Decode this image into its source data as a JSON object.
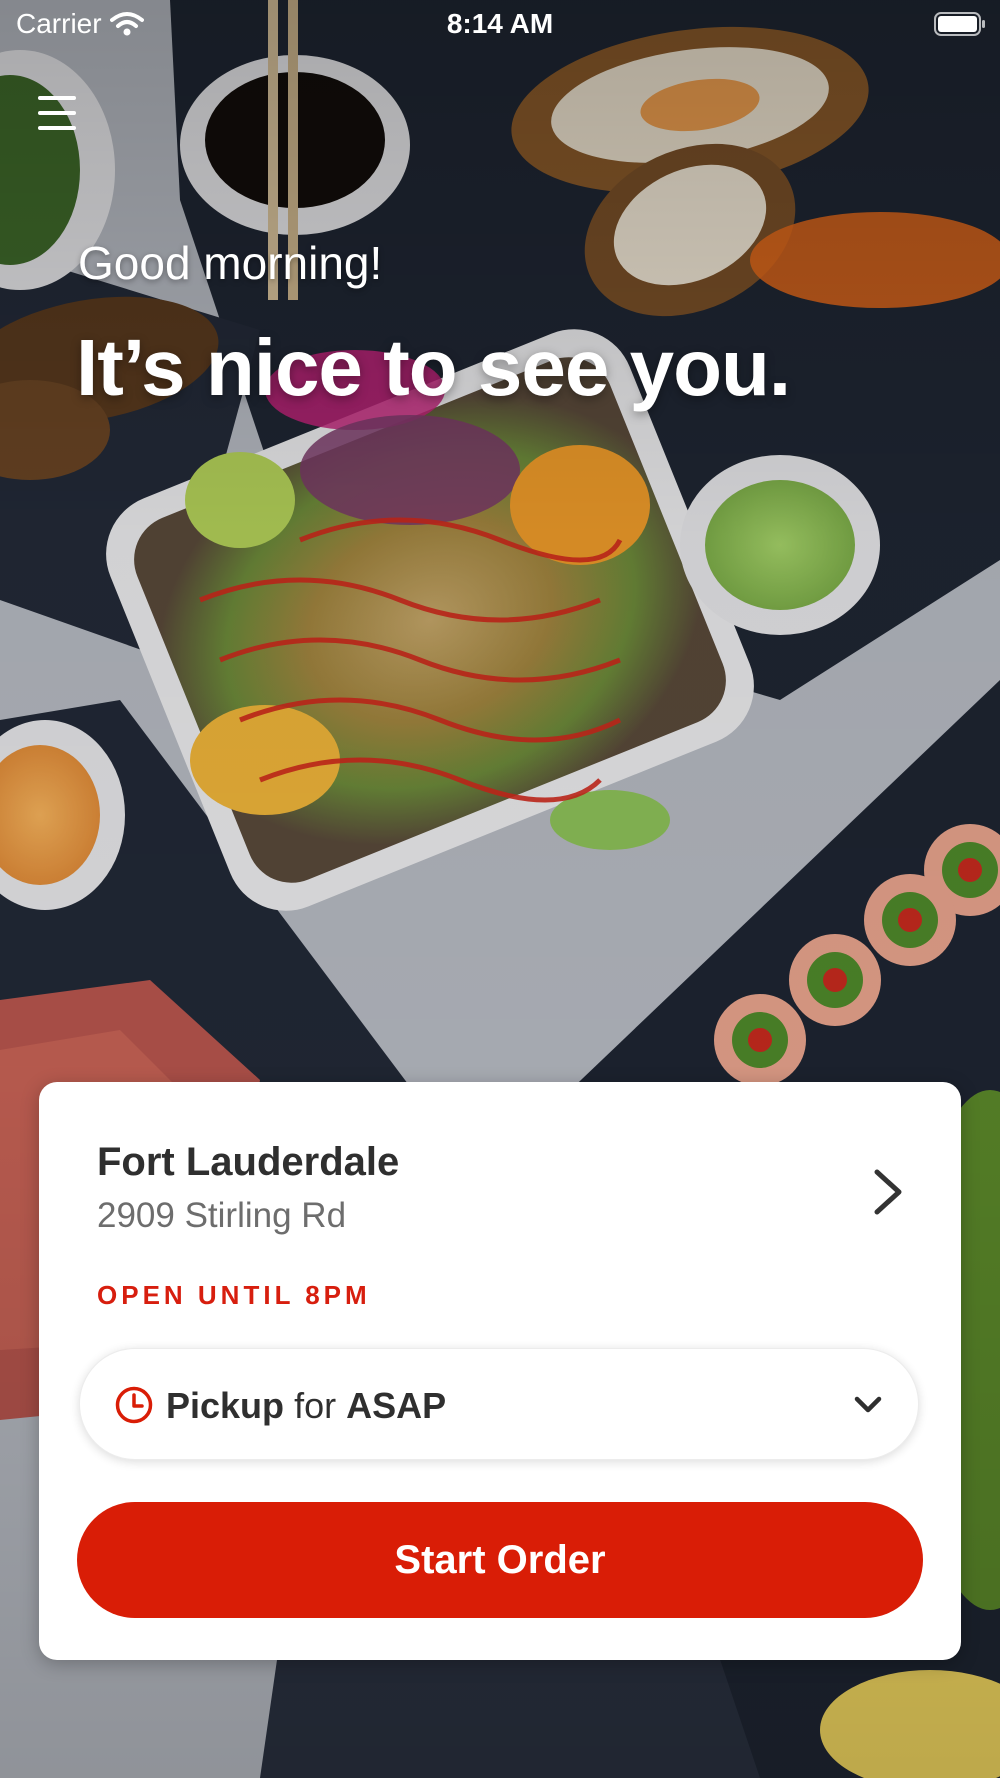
{
  "status_bar": {
    "carrier": "Carrier",
    "time": "8:14 AM",
    "wifi_icon": "wifi-icon",
    "battery_icon": "battery-icon"
  },
  "menu": {
    "icon": "hamburger-menu-icon"
  },
  "greeting": {
    "line1": "Good morning!",
    "line2": "It’s nice to see you."
  },
  "location_card": {
    "store_name": "Fort Lauderdale",
    "address": "2909 Stirling Rd",
    "hours": "OPEN UNTIL 8PM",
    "chevron_icon": "chevron-right-icon"
  },
  "order_type": {
    "icon": "clock-icon",
    "mode": "Pickup",
    "connector": "for",
    "time": "ASAP",
    "dropdown_icon": "chevron-down-icon"
  },
  "cta": {
    "label": "Start Order"
  },
  "colors": {
    "brand_red": "#d91d06",
    "hours_red": "#d71e0e",
    "card_bg": "#ffffff",
    "text_dark": "#2f2f2f",
    "text_muted": "#6d6d6d"
  }
}
